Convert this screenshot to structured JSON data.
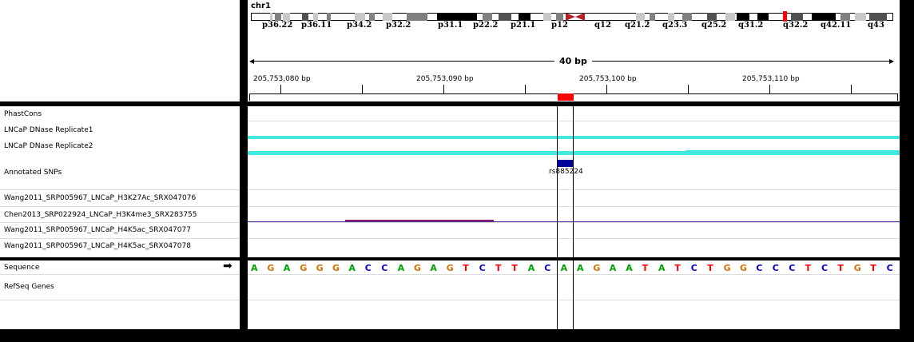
{
  "header": {
    "chromosome": "chr1",
    "width_label": "40 bp",
    "coordinates": [
      "205,753,080 bp",
      "205,753,090 bp",
      "205,753,100 bp",
      "205,753,110 bp"
    ]
  },
  "ideogram": {
    "bands": [
      "p36.22",
      "p36.11",
      "p34.2",
      "p32.2",
      "p31.1",
      "p22.2",
      "p21.1",
      "p12",
      "q12",
      "q21.2",
      "q23.3",
      "q25.2",
      "q31.2",
      "q32.2",
      "q42.11",
      "q43"
    ],
    "current_region_color": "#ff0000",
    "centromere_color": "#b22222"
  },
  "tracks": {
    "data_tracks": [
      "PhastCons",
      "LNCaP DNase Replicate1",
      "LNCaP DNase Replicate2",
      "Annotated SNPs",
      "Wang2011_SRP005967_LNCaP_H3K27Ac_SRX047076",
      "Chen2013_SRP022924_LNCaP_H3K4me3_SRX283755",
      "Wang2011_SRP005967_LNCaP_H4K5ac_SRX047077",
      "Wang2011_SRP005967_LNCaP_H4K5ac_SRX047078"
    ],
    "feature_tracks": [
      "Sequence",
      "RefSeq Genes"
    ],
    "sequence_arrow": "➡"
  },
  "snp": {
    "label": "rs885224",
    "color": "#00009b"
  },
  "dnase_color": "#40e8e0",
  "sequence": [
    "A",
    "G",
    "A",
    "G",
    "G",
    "G",
    "A",
    "C",
    "C",
    "A",
    "G",
    "A",
    "G",
    "T",
    "C",
    "T",
    "T",
    "A",
    "C",
    "A",
    "A",
    "G",
    "A",
    "A",
    "T",
    "A",
    "T",
    "C",
    "T",
    "G",
    "G",
    "C",
    "C",
    "C",
    "T",
    "C",
    "T",
    "G",
    "T",
    "C"
  ],
  "base_colors": {
    "A": "#00a000",
    "C": "#0000c8",
    "G": "#d17105",
    "T": "#ff0000"
  }
}
